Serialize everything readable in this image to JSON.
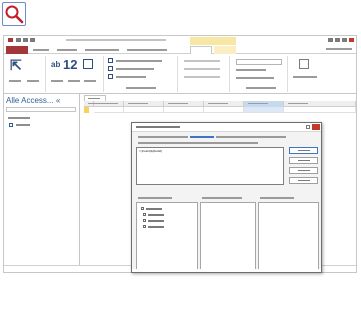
{
  "ribbon": {
    "font_size_value": "12"
  },
  "nav_pane": {
    "title": "Alle Access...",
    "dropdown_glyph": "«"
  },
  "expression_builder": {
    "expression_text": "= [Feld1]&[Feld2]"
  },
  "colors": {
    "file_tab": "#a4373a",
    "context_tab": "#f7e6a4",
    "accent_blue": "#2f5e94",
    "close": "#c0392b"
  },
  "icons": [
    "magnifier-icon",
    "save-icon",
    "undo-icon",
    "redo-icon",
    "close-icon",
    "help-icon",
    "table-icon"
  ]
}
